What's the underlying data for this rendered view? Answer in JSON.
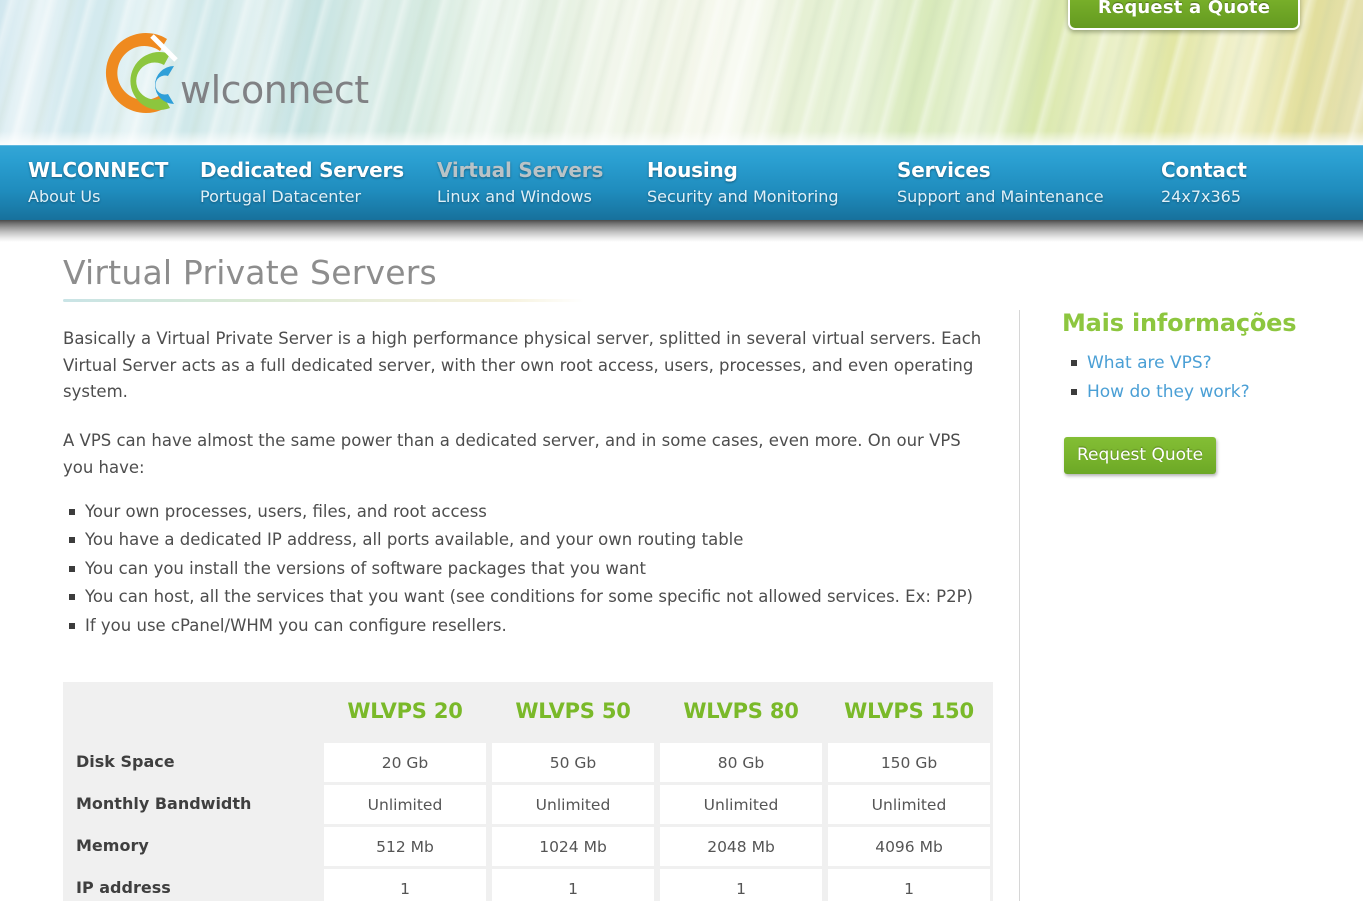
{
  "brand": {
    "logo_text": "wlconnect",
    "logo_colors": {
      "outer": "#ef8a1f",
      "middle": "#8cc63e",
      "inner": "#2f9fd8"
    }
  },
  "header": {
    "quote_button_label": "Request a Quote"
  },
  "nav": {
    "items": [
      {
        "title": "WLCONNECT",
        "subtitle": "About Us",
        "active": false
      },
      {
        "title": "Dedicated Servers",
        "subtitle": "Portugal Datacenter",
        "active": false
      },
      {
        "title": "Virtual Servers",
        "subtitle": "Linux and Windows",
        "active": true
      },
      {
        "title": "Housing",
        "subtitle": "Security and Monitoring",
        "active": false
      },
      {
        "title": "Services",
        "subtitle": "Support and Maintenance",
        "active": false
      },
      {
        "title": "Contact",
        "subtitle": "24x7x365",
        "active": false
      }
    ]
  },
  "main": {
    "page_title": "Virtual Private Servers",
    "paragraph_1": "Basically a Virtual Private Server is a high performance physical server, splitted in several virtual servers. Each Virtual Server acts as a full dedicated server, with ther own root access, users, processes, and even operating system.",
    "paragraph_2": "A VPS can have almost the same power than a dedicated server, and in some cases, even more. On our VPS you have:",
    "features": [
      "Your own processes, users, files, and root access",
      "You have a dedicated IP address, all ports available, and your own routing table",
      " You can you install the versions of software packages that you want",
      "You can host, all the services that you want (see conditions for some specific not allowed services. Ex: P2P)",
      "If you use cPanel/WHM you can configure resellers."
    ]
  },
  "spec_table": {
    "corner_label": "",
    "plans": [
      "WLVPS 20",
      "WLVPS 50",
      "WLVPS 80",
      "WLVPS 150"
    ],
    "rows": [
      {
        "label": "Disk Space",
        "values": [
          "20 Gb",
          "50 Gb",
          "80 Gb",
          "150 Gb"
        ]
      },
      {
        "label": "Monthly Bandwidth",
        "values": [
          "Unlimited",
          "Unlimited",
          "Unlimited",
          "Unlimited"
        ]
      },
      {
        "label": "Memory",
        "values": [
          "512 Mb",
          "1024 Mb",
          "2048 Mb",
          "4096 Mb"
        ]
      },
      {
        "label": "IP address",
        "values": [
          "1",
          "1",
          "1",
          "1"
        ]
      }
    ]
  },
  "sidebar": {
    "title": "Mais informações",
    "links": [
      "What are VPS?",
      "How do they work?"
    ],
    "quote_button_label": "Request Quote"
  },
  "colors": {
    "nav_blue_top": "#34a6d6",
    "nav_blue_bottom": "#17719c",
    "brand_green": "#8dc63f",
    "table_header_green": "#7ab929",
    "link_blue": "#4a9fd5",
    "title_gray": "#8d8d8d"
  }
}
